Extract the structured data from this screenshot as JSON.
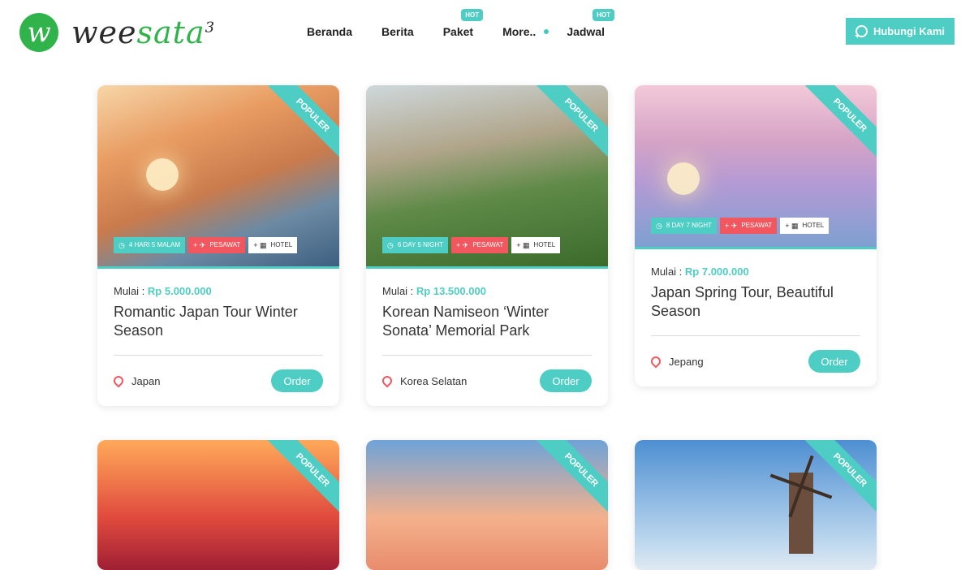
{
  "brand": {
    "initial": "w",
    "name_part1": "wee",
    "name_part2": "sata",
    "sup": "3"
  },
  "nav": [
    {
      "label": "Beranda",
      "badge": ""
    },
    {
      "label": "Berita",
      "badge": ""
    },
    {
      "label": "Paket",
      "badge": "HOT"
    },
    {
      "label": "More..",
      "badge": ""
    },
    {
      "label": "Jadwal",
      "badge": "HOT"
    }
  ],
  "contact_button": "Hubungi Kami",
  "ribbon_label": "POPULER",
  "price_prefix": "Mulai :",
  "order_label": "Order",
  "tag_flight": "PESAWAT",
  "tag_hotel": "HOTEL",
  "cards": [
    {
      "duration": "4 HARI 5 MALAM",
      "price": "Rp 5.000.000",
      "title": "Romantic Japan Tour Winter Season",
      "location": "Japan"
    },
    {
      "duration": "6 DAY 5 NIGHT",
      "price": "Rp 13.500.000",
      "title": "Korean Namiseon ‘Winter Sonata’ Memorial Park",
      "location": "Korea Selatan"
    },
    {
      "duration": "8 DAY 7 NIGHT",
      "price": "Rp 7.000.000",
      "title": "Japan Spring Tour, Beautiful Season",
      "location": "Jepang"
    }
  ],
  "colors": {
    "accent": "#4ecdc4",
    "flight_tag": "#f2575f",
    "logo_green": "#2fb34a"
  },
  "icons": {
    "contact": "whatsapp-icon",
    "location": "map-pin-icon",
    "duration": "clock-icon",
    "flight": "plane-icon",
    "hotel": "building-icon"
  }
}
